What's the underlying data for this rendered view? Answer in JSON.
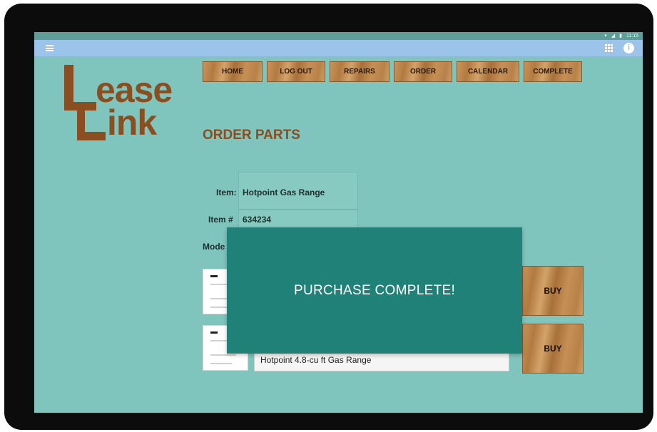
{
  "status_bar": {
    "time": "11:15"
  },
  "logo": {
    "line1": "ease",
    "line2": "ink"
  },
  "nav": [
    {
      "label": "HOME"
    },
    {
      "label": "LOG OUT"
    },
    {
      "label": "REPAIRS"
    },
    {
      "label": "ORDER"
    },
    {
      "label": "CALENDAR"
    },
    {
      "label": "COMPLETE"
    }
  ],
  "page": {
    "title": "ORDER PARTS"
  },
  "item": {
    "label": "Item:",
    "value": "Hotpoint Gas Range"
  },
  "item_number": {
    "label": "Item #",
    "value": "634234"
  },
  "model": {
    "label": "Mode"
  },
  "products": [
    {
      "buy_label": "BUY"
    },
    {
      "description": "Hotpoint  4.8-cu ft Gas Range",
      "buy_label": "BUY"
    }
  ],
  "toast": {
    "message": "PURCHASE COMPLETE!"
  },
  "colors": {
    "background": "#7fc5bd",
    "app_bar": "#9cc3ea",
    "brand_brown": "#8a4e21",
    "toast": "#1f8177"
  },
  "icons": [
    "menu-icon",
    "grid-icon",
    "info-icon",
    "wifi-icon",
    "signal-icon",
    "battery-icon"
  ]
}
